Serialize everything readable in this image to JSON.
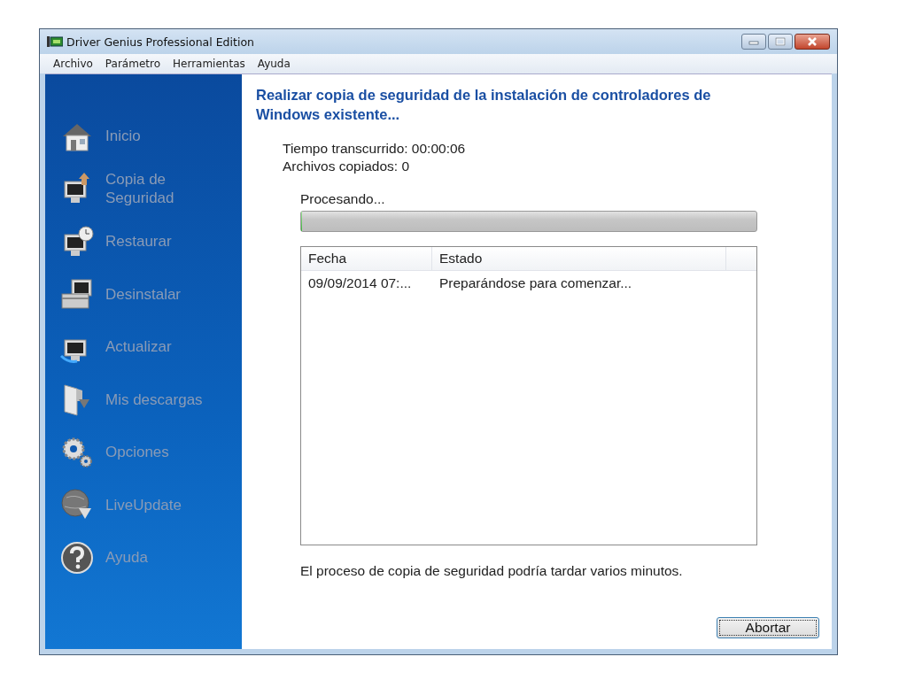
{
  "window": {
    "title": "Driver Genius Professional Edition"
  },
  "menu": [
    "Archivo",
    "Parámetro",
    "Herramientas",
    "Ayuda"
  ],
  "sidebar": {
    "items": [
      {
        "label": "Inicio",
        "disabled": true
      },
      {
        "label": "Copia de Seguridad",
        "disabled": true
      },
      {
        "label": "Restaurar",
        "disabled": true
      },
      {
        "label": "Desinstalar",
        "disabled": true
      },
      {
        "label": "Actualizar",
        "disabled": true
      },
      {
        "label": "Mis descargas",
        "disabled": true
      },
      {
        "label": "Opciones",
        "disabled": true
      },
      {
        "label": "LiveUpdate",
        "disabled": true
      },
      {
        "label": "Ayuda",
        "disabled": true
      }
    ]
  },
  "heading": "Realizar copia de seguridad de la instalación de controladores de Windows existente...",
  "stats": [
    "Tiempo transcurrido: 00:00:06",
    "Archivos copiados: 0"
  ],
  "progress_label": "Procesando...",
  "progress": {
    "level": 0
  },
  "table": {
    "columns": [
      "Fecha",
      "Estado"
    ],
    "rows": [
      [
        "09/09/2014 07:...",
        "Preparándose para comenzar..."
      ]
    ]
  },
  "note": "El proceso de copia de seguridad podría tardar varios minutos.",
  "buttons": [
    "Abortar"
  ]
}
